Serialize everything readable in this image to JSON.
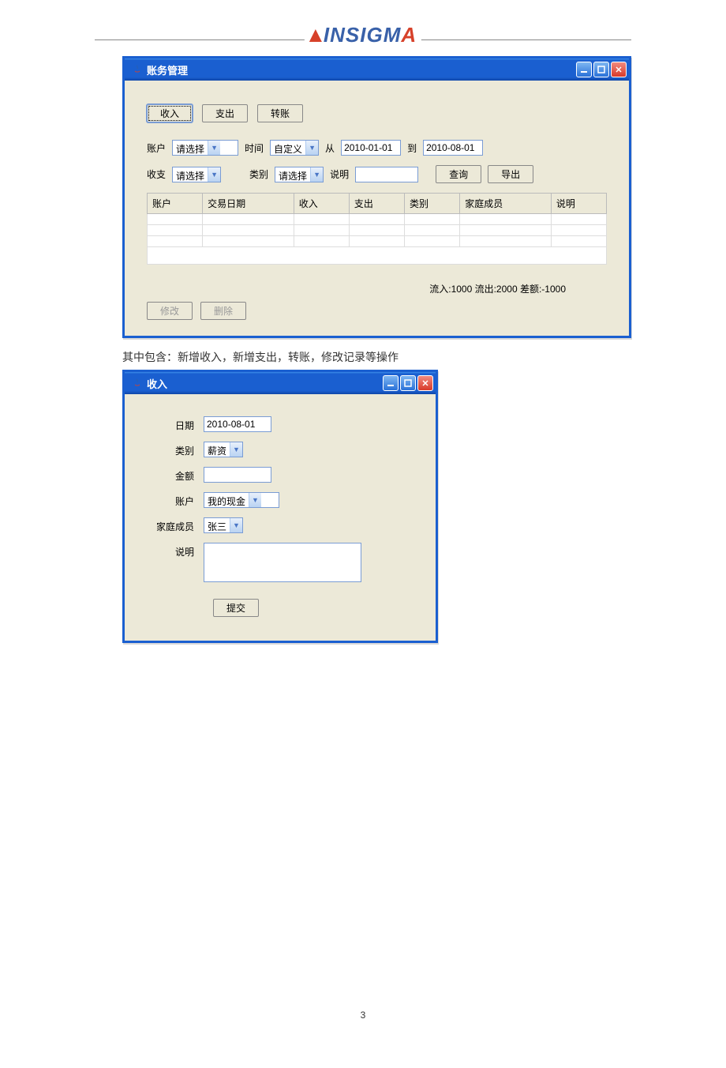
{
  "header": {
    "logo_text": "INSIGMA"
  },
  "window1": {
    "title": "账务管理",
    "toolbar": {
      "income": "收入",
      "expense": "支出",
      "transfer": "转账"
    },
    "filters": {
      "account_label": "账户",
      "account_value": "请选择",
      "time_label": "时间",
      "time_value": "自定义",
      "from_label": "从",
      "from_value": "2010-01-01",
      "to_label": "到",
      "to_value": "2010-08-01",
      "inout_label": "收支",
      "inout_value": "请选择",
      "category_label": "类别",
      "category_value": "请选择",
      "note_label": "说明",
      "query_btn": "查询",
      "export_btn": "导出"
    },
    "table": {
      "headers": [
        "账户",
        "交易日期",
        "收入",
        "支出",
        "类别",
        "家庭成员",
        "说明"
      ]
    },
    "summary": "流入:1000 流出:2000 差额:-1000",
    "actions": {
      "edit": "修改",
      "delete": "删除"
    }
  },
  "caption": "其中包含：新增收入，新增支出，转账，修改记录等操作",
  "window2": {
    "title": "收入",
    "form": {
      "date_label": "日期",
      "date_value": "2010-08-01",
      "category_label": "类别",
      "category_value": "薪资",
      "amount_label": "金额",
      "amount_value": "",
      "account_label": "账户",
      "account_value": "我的现金",
      "member_label": "家庭成员",
      "member_value": "张三",
      "note_label": "说明",
      "note_value": "",
      "submit": "提交"
    }
  },
  "page_number": "3"
}
